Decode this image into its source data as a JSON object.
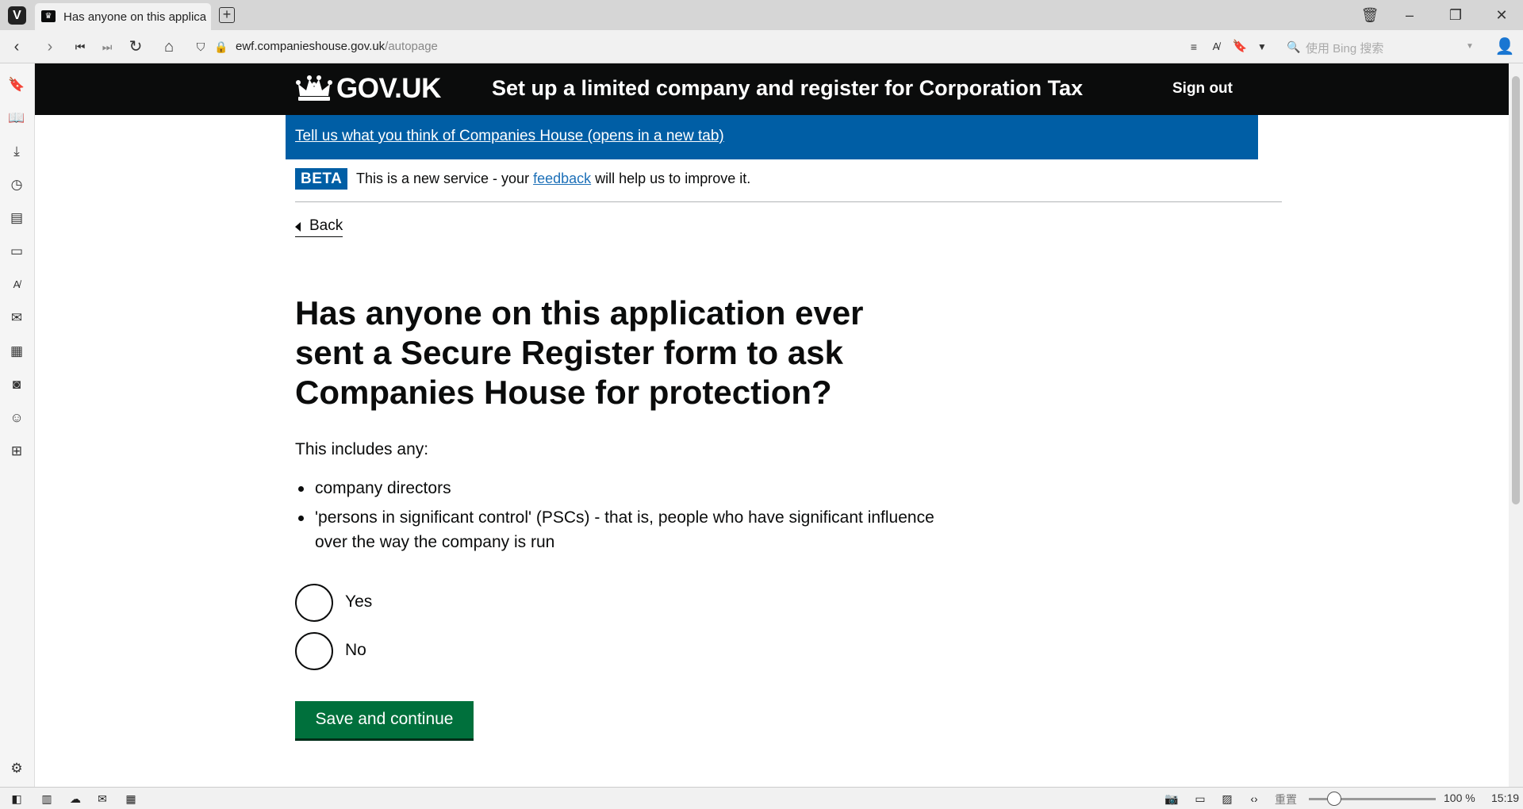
{
  "browser": {
    "tab_title": "Has anyone on this applicat",
    "url_domain": "ewf.companieshouse.gov.uk",
    "url_path": "/autopage",
    "search_placeholder": "使用 Bing 搜索",
    "zoom_reset_label": "重置",
    "zoom_level": "100 %",
    "clock": "15:19"
  },
  "header": {
    "logo_text": "GOV.UK",
    "service_name": "Set up a limited company and register for Corporation Tax",
    "sign_out": "Sign out"
  },
  "feedback_banner": {
    "link": "Tell us what you think of Companies House (opens in a new tab)"
  },
  "phase_banner": {
    "tag": "BETA",
    "text_before": "This is a new service - your ",
    "link": "feedback",
    "text_after": " will help us to improve it."
  },
  "back_link": "Back",
  "question": "Has anyone on this application ever sent a Secure Register form to ask Companies House for protection?",
  "includes_label": "This includes any:",
  "bullets": [
    "company directors",
    "'persons in significant control' (PSCs) - that is, people who have significant influence over the way the company is run"
  ],
  "options": [
    "Yes",
    "No"
  ],
  "submit": "Save and continue"
}
